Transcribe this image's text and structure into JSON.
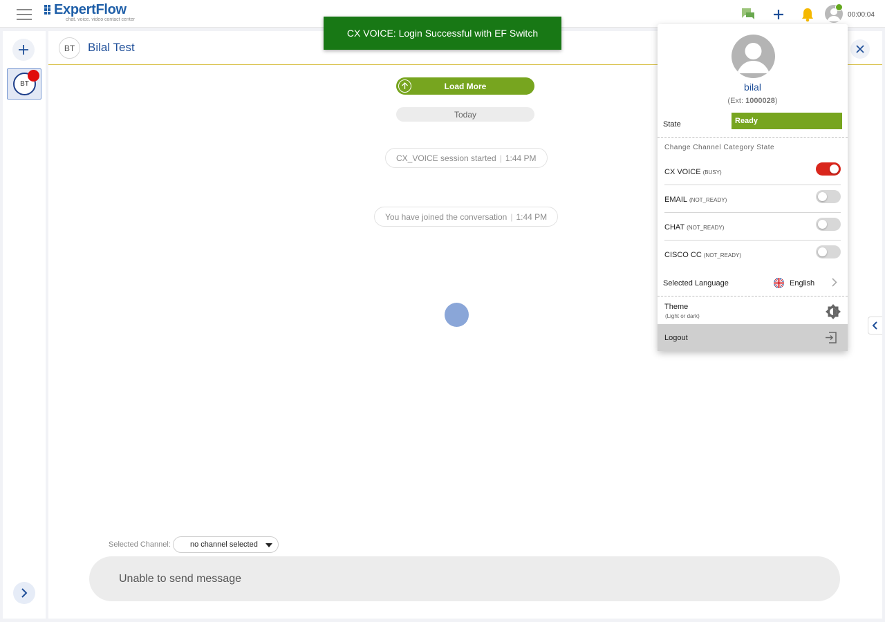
{
  "app": {
    "logo_text": "ExpertFlow",
    "logo_tagline": "chat. voice. video contact center",
    "timer": "00:00:04"
  },
  "toast": {
    "message": "CX VOICE: Login Successful with EF Switch",
    "color": "#187815"
  },
  "conversation": {
    "avatar_initials": "BT",
    "customer_name": "Bilal Test",
    "load_more_label": "Load More",
    "date_divider": "Today",
    "system_messages": [
      {
        "text": "CX_VOICE session started",
        "time": "1:44 PM"
      },
      {
        "text": "You have joined the conversation",
        "time": "1:44 PM"
      }
    ]
  },
  "sidebar": {
    "conversation_tiles": [
      {
        "initials": "BT"
      }
    ]
  },
  "composer": {
    "channel_label": "Selected Channel:",
    "channel_value": "no channel selected",
    "input_text": "Unable to send message"
  },
  "profile": {
    "name": "bilal",
    "ext_prefix": "(Ext: ",
    "ext_number": "1000028",
    "ext_suffix": ")",
    "state_label": "State",
    "state_value": "Ready",
    "state_color": "#77a51f",
    "section_title": "Change Channel Category State",
    "channels": [
      {
        "name": "CX VOICE",
        "state": "(BUSY)",
        "enabled": true
      },
      {
        "name": "EMAIL",
        "state": "(NOT_READY)",
        "enabled": false
      },
      {
        "name": "CHAT",
        "state": "(NOT_READY)",
        "enabled": false
      },
      {
        "name": "CISCO CC",
        "state": "(NOT_READY)",
        "enabled": false
      }
    ],
    "language_label": "Selected Language",
    "language_value": "English",
    "theme_label": "Theme",
    "theme_sub": "(Light or dark)",
    "logout_label": "Logout"
  },
  "icons": {
    "hamburger": "menu-icon",
    "chat": "chat-bubbles-icon",
    "add": "plus-icon",
    "notifications": "bell-icon",
    "user": "user-avatar-icon",
    "close": "close-icon",
    "language_flag": "uk-flag-icon",
    "theme": "brightness-icon",
    "logout": "logout-icon"
  }
}
